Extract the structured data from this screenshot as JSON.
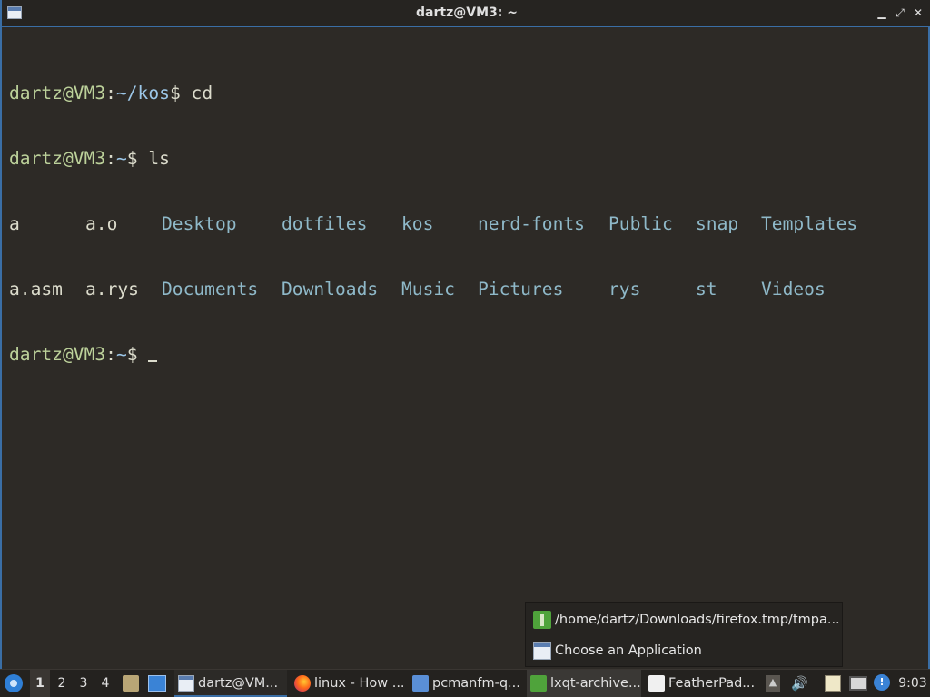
{
  "window": {
    "title": "dartz@VM3: ~"
  },
  "terminal": {
    "lines": [
      {
        "user": "dartz@VM3",
        "sep": ":",
        "path": "~/kos",
        "prompt": "$ ",
        "cmd": "cd"
      },
      {
        "user": "dartz@VM3",
        "sep": ":",
        "path": "~",
        "prompt": "$ ",
        "cmd": "ls"
      }
    ],
    "ls_row1": [
      "a",
      "a.o",
      "Desktop",
      "dotfiles",
      "kos",
      "nerd-fonts",
      "Public",
      "snap",
      "Templates"
    ],
    "ls_row2": [
      "a.asm",
      "a.rys",
      "Documents",
      "Downloads",
      "Music",
      "Pictures",
      "rys",
      "st",
      "Videos"
    ],
    "current_prompt": {
      "user": "dartz@VM3",
      "sep": ":",
      "path": "~",
      "prompt": "$ "
    }
  },
  "popup": {
    "items": [
      {
        "label": "/home/dartz/Downloads/firefox.tmp/tmpa...",
        "icon": "archive-icon"
      },
      {
        "label": "Choose an Application",
        "icon": "window-icon"
      }
    ]
  },
  "taskbar": {
    "desktops": [
      "1",
      "2",
      "3",
      "4"
    ],
    "tasks": [
      {
        "label": "dartz@VM...",
        "icon": "terminal-icon"
      },
      {
        "label": "linux - How ...",
        "icon": "firefox-icon"
      },
      {
        "label": "pcmanfm-q...",
        "icon": "folder-icon"
      },
      {
        "label": "lxqt-archive...",
        "icon": "archive-icon"
      },
      {
        "label": "FeatherPad...",
        "icon": "featherpad-icon"
      }
    ],
    "clock": "9:03"
  },
  "colors": {
    "accent": "#3a6ea5",
    "terminal_bg": "#2d2a26",
    "user_green": "#bcd19a",
    "dir_blue": "#8fb9c9"
  }
}
